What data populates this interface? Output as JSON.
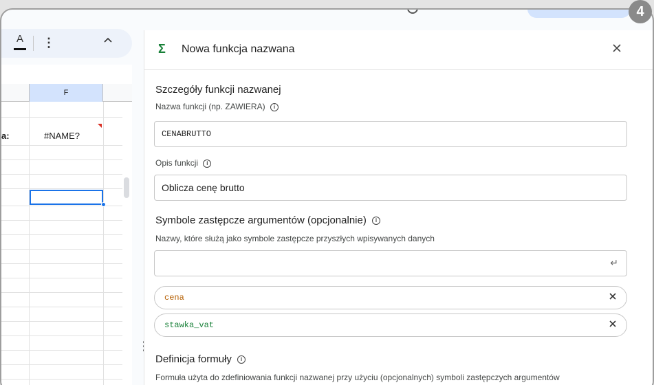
{
  "step_badge": "4",
  "toolbar": {
    "text_color_icon": "A",
    "more_icon": "⋮",
    "collapse_icon": "^"
  },
  "sheet": {
    "column_header": "F",
    "partial_label": "a:",
    "cell_value": "#NAME?"
  },
  "panel": {
    "title": "Nowa funkcja nazwana",
    "section_details": "Szczegóły funkcji nazwanej",
    "name_label": "Nazwa funkcji (np. ZAWIERA)",
    "name_value": "CENABRUTTO",
    "desc_label": "Opis funkcji",
    "desc_value": "Oblicza cenę brutto",
    "placeholders_title": "Symbole zastępcze argumentów (opcjonalnie)",
    "placeholders_hint": "Nazwy, które służą jako symbole zastępcze przyszłych wpisywanych danych",
    "placeholder_input_value": "",
    "chips": [
      {
        "label": "cena",
        "color": "#b55e00"
      },
      {
        "label": "stawka_vat",
        "color": "#188038"
      }
    ],
    "definition_title": "Definicja formuły",
    "definition_hint": "Formuła użyta do zdefiniowania funkcji nazwanej przy użyciu (opcjonalnych) symboli zastępczych argumentów"
  },
  "colors": {
    "accent": "#1a73e8",
    "sigma": "#188038",
    "selected_header": "#d3e3fd"
  }
}
